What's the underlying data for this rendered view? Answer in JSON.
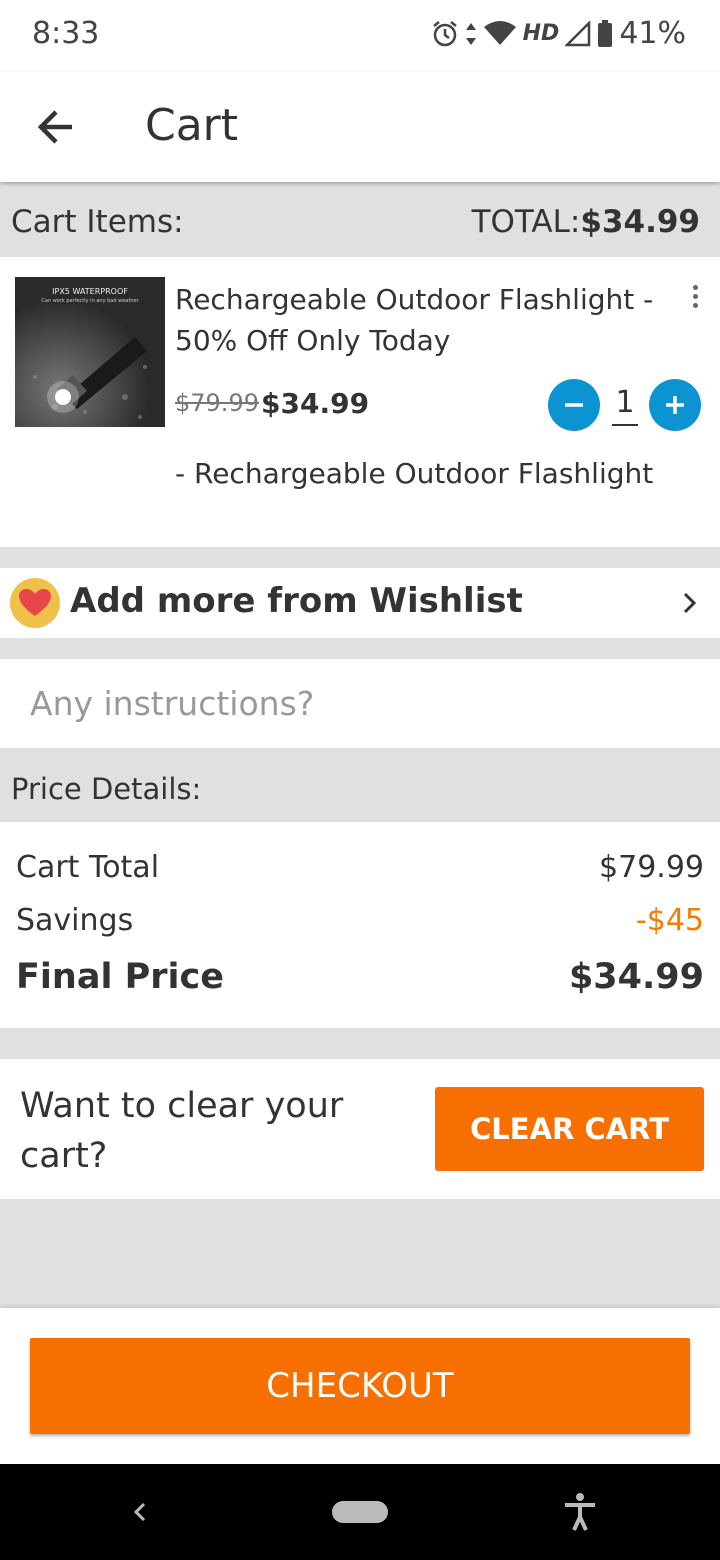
{
  "status_bar": {
    "time": "8:33",
    "network": "HD",
    "battery": "41%",
    "icons": [
      "alarm-icon",
      "data-arrows-icon",
      "wifi-icon",
      "signal-icon",
      "battery-icon"
    ]
  },
  "app_bar": {
    "title": "Cart",
    "back_icon": "arrow-back-icon"
  },
  "cart_header": {
    "label": "Cart Items:",
    "total_label": "TOTAL:",
    "total_value": "$34.99"
  },
  "item": {
    "name": "Rechargeable Outdoor Flashlight - 50% Off Only Today",
    "image_caption": "IPX5 WATERPROOF",
    "image_subcaption": "Can work perfectly in any bad weather",
    "original_price": "$79.99",
    "price": "$34.99",
    "quantity": "1",
    "variant": "- Rechargeable Outdoor Flashlight"
  },
  "wishlist": {
    "label": "Add more from Wishlist"
  },
  "instructions": {
    "placeholder": "Any instructions?"
  },
  "price_details": {
    "heading": "Price Details:",
    "rows": [
      {
        "label": "Cart Total",
        "value": "$79.99"
      },
      {
        "label": "Savings",
        "value": "-$45"
      },
      {
        "label": "Final Price",
        "value": "$34.99"
      }
    ]
  },
  "clear_cart": {
    "prompt": "Want to clear your cart?",
    "button": "CLEAR CART"
  },
  "checkout": {
    "button": "CHECKOUT"
  },
  "colors": {
    "accent_orange": "#f76f00",
    "qty_blue": "#0b93d2",
    "savings_orange": "#f57c00",
    "background": "#e0e0e0"
  }
}
